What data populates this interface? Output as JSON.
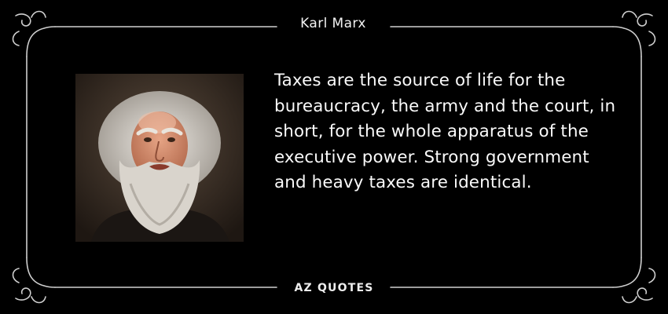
{
  "author": "Karl Marx",
  "quote": "Taxes are the source of life for the bureaucracy, the army and the court, in short, for the whole apparatus of the executive power. Strong government and heavy taxes are identical.",
  "brand": "AZ QUOTES",
  "colors": {
    "background": "#000000",
    "text": "#ffffff",
    "frame": "#cfcfcf"
  }
}
